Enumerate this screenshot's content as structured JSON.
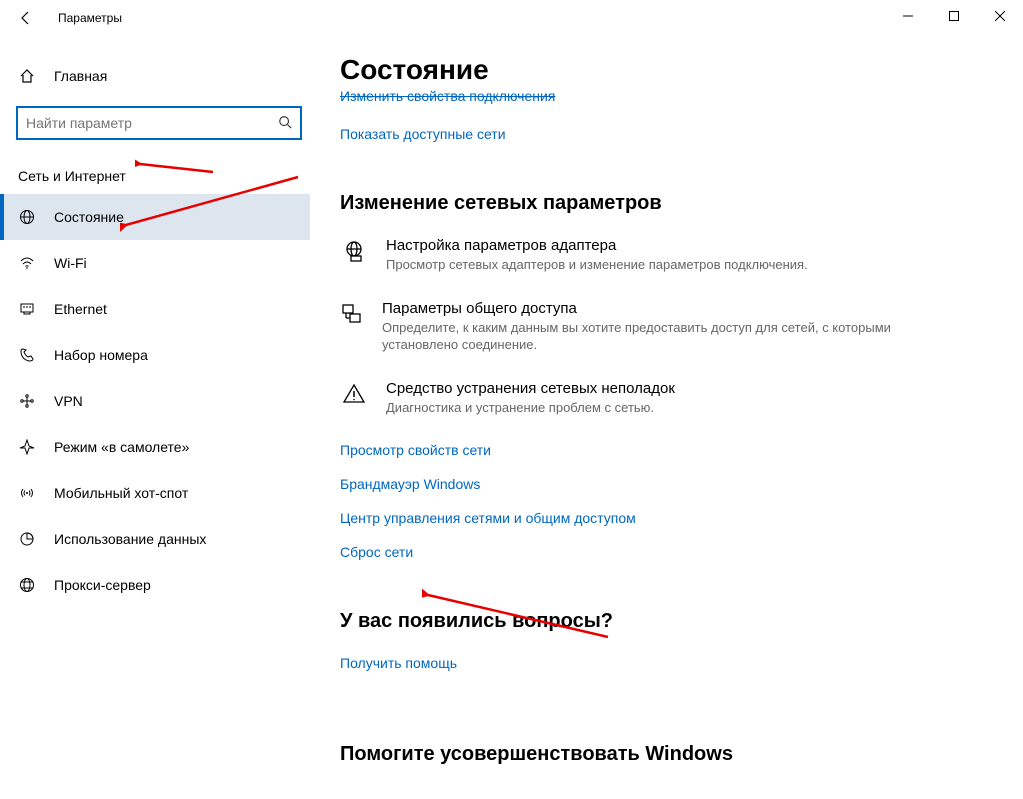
{
  "window": {
    "title": "Параметры"
  },
  "sidebar": {
    "home": "Главная",
    "search_placeholder": "Найти параметр",
    "section": "Сеть и Интернет",
    "items": [
      {
        "label": "Состояние",
        "active": true
      },
      {
        "label": "Wi-Fi"
      },
      {
        "label": "Ethernet"
      },
      {
        "label": "Набор номера"
      },
      {
        "label": "VPN"
      },
      {
        "label": "Режим «в самолете»"
      },
      {
        "label": "Мобильный хот-спот"
      },
      {
        "label": "Использование данных"
      },
      {
        "label": "Прокси-сервер"
      }
    ]
  },
  "content": {
    "heading": "Состояние",
    "truncated_link": "Изменить свойства подключения",
    "show_networks": "Показать доступные сети",
    "change_heading": "Изменение сетевых параметров",
    "options": [
      {
        "title": "Настройка параметров адаптера",
        "desc": "Просмотр сетевых адаптеров и изменение параметров подключения."
      },
      {
        "title": "Параметры общего доступа",
        "desc": "Определите, к каким данным вы хотите предоставить доступ для сетей, с которыми установлено соединение."
      },
      {
        "title": "Средство устранения сетевых неполадок",
        "desc": "Диагностика и устранение проблем с сетью."
      }
    ],
    "links": [
      "Просмотр свойств сети",
      "Брандмауэр Windows",
      "Центр управления сетями и общим доступом",
      "Сброс сети"
    ],
    "questions_heading": "У вас появились вопросы?",
    "get_help": "Получить помощь",
    "improve_heading": "Помогите усовершенствовать Windows"
  }
}
